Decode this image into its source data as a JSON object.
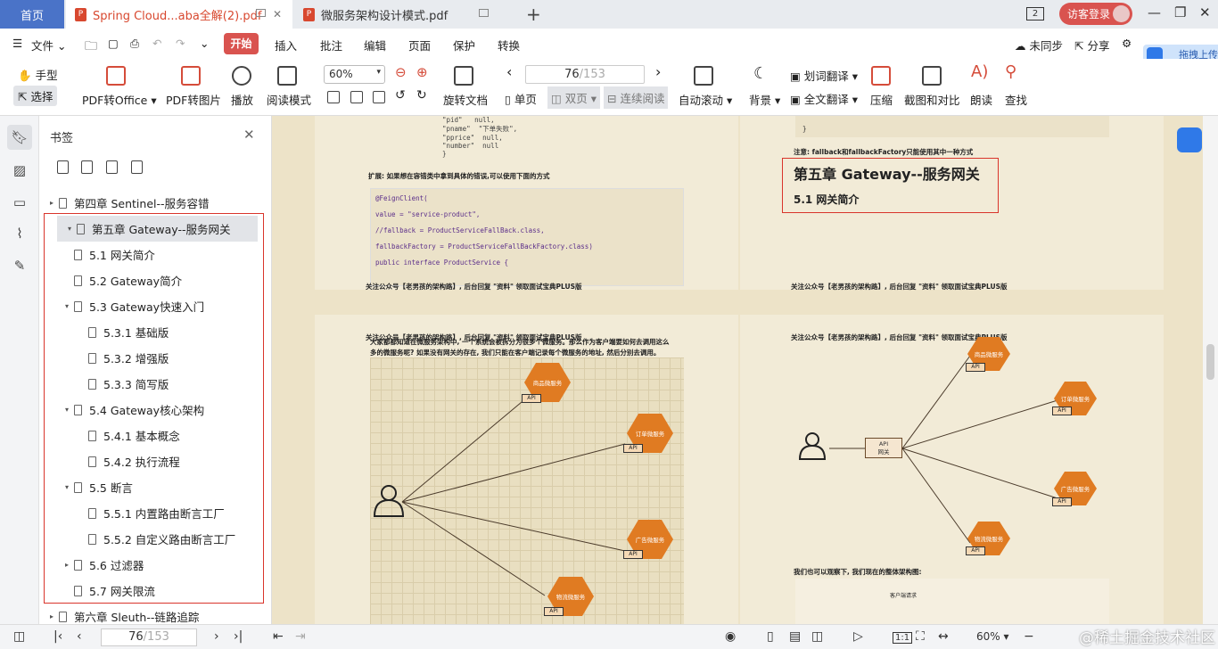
{
  "tabs": [
    {
      "label": "首页"
    },
    {
      "label": "Spring Cloud...aba全解(2).pdf"
    },
    {
      "label": "微服务架构设计模式.pdf"
    }
  ],
  "window": {
    "counter": "2",
    "login_label": "访客登录"
  },
  "menu": {
    "file": "文件",
    "items": [
      "开始",
      "插入",
      "批注",
      "编辑",
      "页面",
      "保护",
      "转换"
    ],
    "sync": "未同步",
    "share": "分享",
    "float_label": "拖拽上传"
  },
  "toolbar": {
    "hand": "手型",
    "select": "选择",
    "pdf_office": "PDF转Office",
    "pdf_image": "PDF转图片",
    "play": "播放",
    "read_mode": "阅读模式",
    "zoom": "60%",
    "rotate": "旋转文档",
    "single": "单页",
    "double": "双页",
    "continuous": "连续阅读",
    "page_current": "76",
    "page_total": "/153",
    "auto_scroll": "自动滚动",
    "background": "背景",
    "word_translate": "划词翻译",
    "full_translate": "全文翻译",
    "compress": "压缩",
    "screenshot": "截图和对比",
    "read_aloud": "朗读",
    "find": "查找"
  },
  "bookmarks": {
    "title": "书签",
    "items": [
      {
        "label": "第四章 Sentinel--服务容错",
        "level": 0,
        "arrow": "▸"
      },
      {
        "label": "第五章 Gateway--服务网关",
        "level": 0,
        "arrow": "▾"
      },
      {
        "label": "5.1 网关简介",
        "level": 1,
        "arrow": ""
      },
      {
        "label": "5.2 Gateway简介",
        "level": 1,
        "arrow": ""
      },
      {
        "label": "5.3 Gateway快速入门",
        "level": 1,
        "arrow": "▾"
      },
      {
        "label": "5.3.1 基础版",
        "level": 2,
        "arrow": ""
      },
      {
        "label": "5.3.2 增强版",
        "level": 2,
        "arrow": ""
      },
      {
        "label": "5.3.3 简写版",
        "level": 2,
        "arrow": ""
      },
      {
        "label": "5.4 Gateway核心架构",
        "level": 1,
        "arrow": "▾"
      },
      {
        "label": "5.4.1 基本概念",
        "level": 2,
        "arrow": ""
      },
      {
        "label": "5.4.2 执行流程",
        "level": 2,
        "arrow": ""
      },
      {
        "label": "5.5 断言",
        "level": 1,
        "arrow": "▾"
      },
      {
        "label": "5.5.1 内置路由断言工厂",
        "level": 2,
        "arrow": ""
      },
      {
        "label": "5.5.2 自定义路由断言工厂",
        "level": 2,
        "arrow": ""
      },
      {
        "label": "5.6 过滤器",
        "level": 1,
        "arrow": "▸"
      },
      {
        "label": "5.7 网关限流",
        "level": 1,
        "arrow": ""
      },
      {
        "label": "第六章 Sleuth--链路追踪",
        "level": 0,
        "arrow": "▸"
      }
    ]
  },
  "page_left_top": {
    "code1": "\"pid\"   null,\n\"pname\"  \"下单失败\",\n\"pprice\"  null,\n\"number\"  null\n}",
    "note": "扩展: 如果想在容错类中拿到具体的错误,可以使用下面的方式",
    "code2": "@FeignClient(\n\nvalue = \"service-product\",\n\n//fallback = ProductServiceFallBack.class,\n\nfallbackFactory = ProductServiceFallBackFactory.class)\n\npublic interface ProductService {",
    "footer": "关注公众号【老男孩的架构路】, 后台回复 \"资料\" 领取面试宝典PLUS版"
  },
  "page_right_top": {
    "brace": "}",
    "note": "注意: fallback和fallbackFactory只能使用其中一种方式",
    "chapter": "第五章 Gateway--服务网关",
    "section": "5.1 网关简介",
    "footer": "关注公众号【老男孩的架构路】, 后台回复 \"资料\" 领取面试宝典PLUS版"
  },
  "page_left_bottom": {
    "header": "关注公众号【老男孩的架构路】, 后台回复 \"资料\" 领取面试宝典PLUS版",
    "para1": "大家都都知道在微服务架构中, 一个系统会被拆分为很多个微服务。那么作为客户端要如何去调用这么",
    "para2": "多的微服务呢? 如果没有网关的存在, 我们只能在客户端记录每个微服务的地址, 然后分别去调用。",
    "services": [
      "商品微服务",
      "订单微服务",
      "广告微服务",
      "物流微服务"
    ],
    "api": "API"
  },
  "page_right_bottom": {
    "header": "关注公众号【老男孩的架构路】, 后台回复 \"资料\" 领取面试宝典PLUS版",
    "services": [
      "商品微服务",
      "订单微服务",
      "广告微服务",
      "物流微服务"
    ],
    "api": "API",
    "gateway": "API\n网关",
    "bottom_note": "我们也可以观察下, 我们现在的整体架构图:",
    "client_label": "客户端请求"
  },
  "status": {
    "page_current": "76",
    "page_total": "/153",
    "zoom": "60%",
    "watermark": "@稀土掘金技术社区"
  }
}
